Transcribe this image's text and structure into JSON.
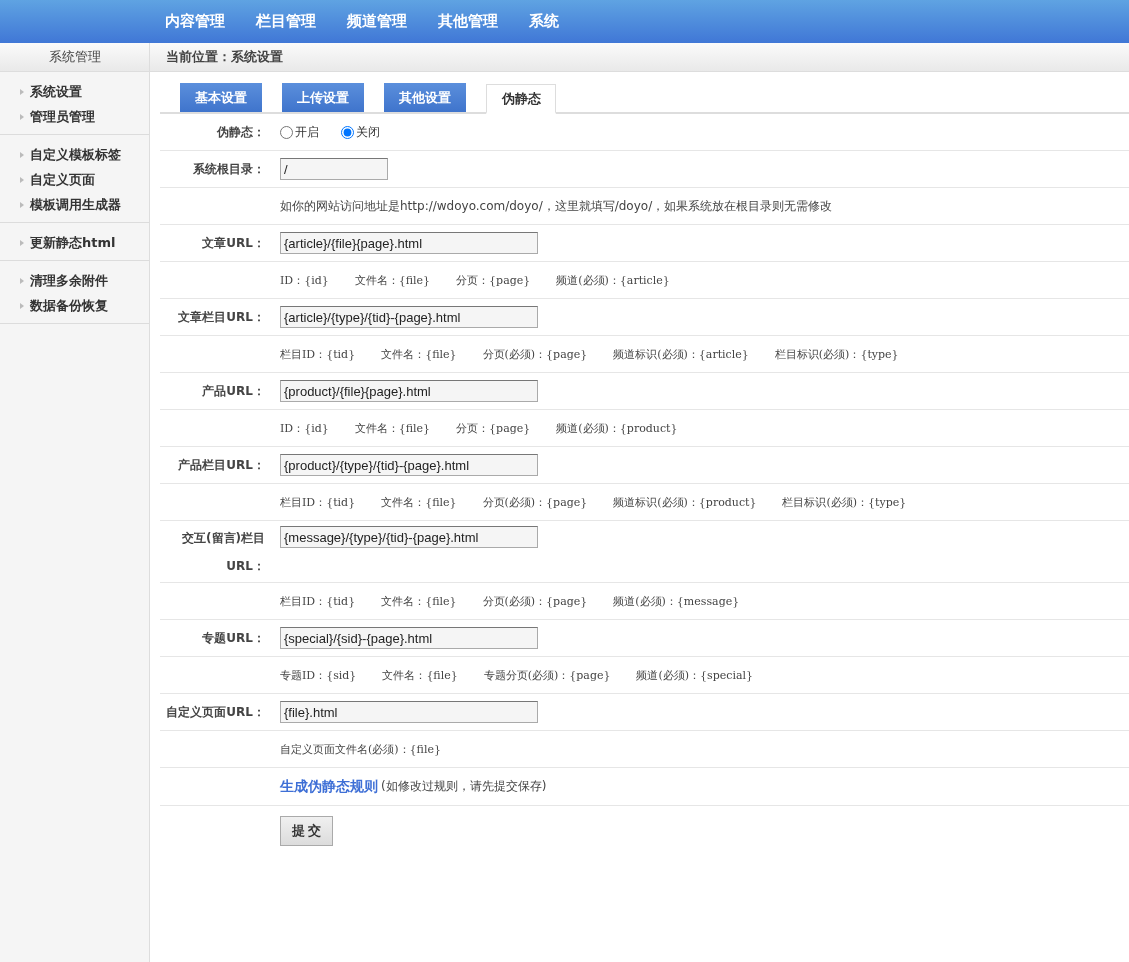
{
  "top_nav": [
    {
      "label": "内容管理"
    },
    {
      "label": "栏目管理"
    },
    {
      "label": "频道管理"
    },
    {
      "label": "其他管理"
    },
    {
      "label": "系统"
    }
  ],
  "sidebar": {
    "title": "系统管理",
    "groups": [
      {
        "items": [
          {
            "label": "系统设置"
          },
          {
            "label": "管理员管理"
          }
        ]
      },
      {
        "items": [
          {
            "label": "自定义模板标签"
          },
          {
            "label": "自定义页面"
          },
          {
            "label": "模板调用生成器"
          }
        ]
      },
      {
        "items": [
          {
            "label": "更新静态html"
          }
        ]
      },
      {
        "items": [
          {
            "label": "清理多余附件"
          },
          {
            "label": "数据备份恢复"
          }
        ]
      }
    ]
  },
  "breadcrumb": "当前位置：系统设置",
  "tabs": [
    {
      "label": "基本设置",
      "selected": false
    },
    {
      "label": "上传设置",
      "selected": false
    },
    {
      "label": "其他设置",
      "selected": false
    },
    {
      "label": "伪静态",
      "selected": true
    }
  ],
  "form_rows": [
    {
      "kind": "radio",
      "label": "伪静态：",
      "options": [
        {
          "label": "开启",
          "selected": false
        },
        {
          "label": "关闭",
          "selected": true
        }
      ]
    },
    {
      "kind": "short_input",
      "label": "系统根目录：",
      "value": "/"
    },
    {
      "kind": "note",
      "text": "如你的网站访问地址是http://wdoyo.com/doyo/，这里就填写/doyo/，如果系统放在根目录则无需修改"
    },
    {
      "kind": "input",
      "label": "文章URL：",
      "value": "{article}/{file}{page}.html"
    },
    {
      "kind": "hints",
      "items": [
        "ID：{id}",
        "文件名：{file}",
        "分页：{page}",
        "频道(必须)：{article}"
      ]
    },
    {
      "kind": "input",
      "label": "文章栏目URL：",
      "value": "{article}/{type}/{tid}-{page}.html"
    },
    {
      "kind": "hints",
      "items": [
        "栏目ID：{tid}",
        "文件名：{file}",
        "分页(必须)：{page}",
        "频道标识(必须)：{article}",
        "栏目标识(必须)：{type}"
      ]
    },
    {
      "kind": "input",
      "label": "产品URL：",
      "value": "{product}/{file}{page}.html"
    },
    {
      "kind": "hints",
      "items": [
        "ID：{id}",
        "文件名：{file}",
        "分页：{page}",
        "频道(必须)：{product}"
      ]
    },
    {
      "kind": "input",
      "label": "产品栏目URL：",
      "value": "{product}/{type}/{tid}-{page}.html"
    },
    {
      "kind": "hints",
      "items": [
        "栏目ID：{tid}",
        "文件名：{file}",
        "分页(必须)：{page}",
        "频道标识(必须)：{product}",
        "栏目标识(必须)：{type}"
      ]
    },
    {
      "kind": "input",
      "label": "交互(留言)栏目URL：",
      "value": "{message}/{type}/{tid}-{page}.html"
    },
    {
      "kind": "hints",
      "items": [
        "栏目ID：{tid}",
        "文件名：{file}",
        "分页(必须)：{page}",
        "频道(必须)：{message}"
      ]
    },
    {
      "kind": "input",
      "label": "专题URL：",
      "value": "{special}/{sid}-{page}.html"
    },
    {
      "kind": "hints",
      "items": [
        "专题ID：{sid}",
        "文件名：{file}",
        "专题分页(必须)：{page}",
        "频道(必须)：{special}"
      ]
    },
    {
      "kind": "input",
      "label": "自定义页面URL：",
      "value": "{file}.html"
    },
    {
      "kind": "hints",
      "items": [
        "自定义页面文件名(必须)：{file}"
      ]
    },
    {
      "kind": "link",
      "link": "生成伪静态规则",
      "text": "(如修改过规则，请先提交保存)"
    }
  ],
  "submit": "提 交"
}
